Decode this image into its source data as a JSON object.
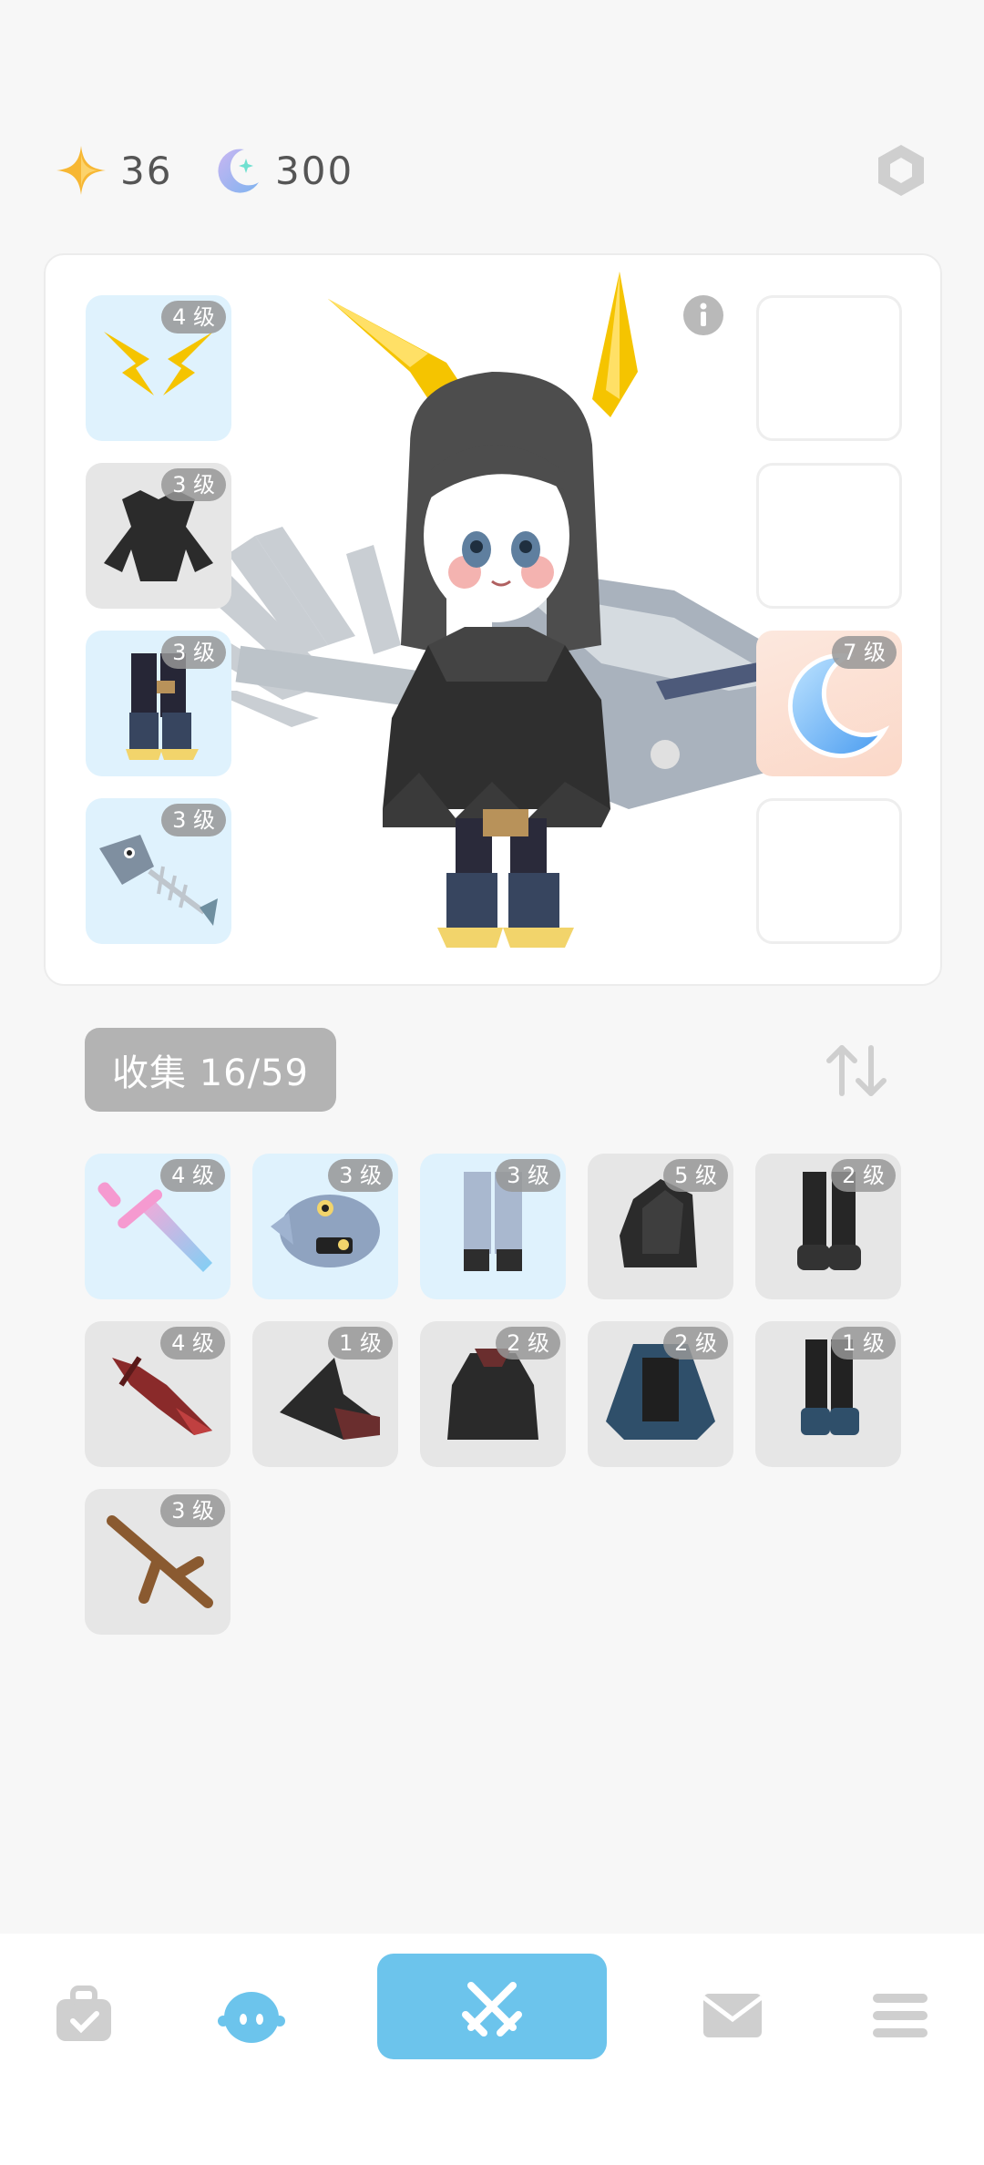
{
  "currencies": {
    "star": {
      "icon": "star-icon",
      "value": "36",
      "color": "#f7b733"
    },
    "moon": {
      "icon": "moon-icon",
      "value": "300",
      "color": "#8fb6f0"
    }
  },
  "settings": {
    "icon": "hexagon-settings-icon"
  },
  "equipment": {
    "left_slots": [
      {
        "name": "horns",
        "level": "4 级",
        "icon": "lightning-horns-icon"
      },
      {
        "name": "armor",
        "level": "3 级",
        "icon": "dark-armor-icon"
      },
      {
        "name": "boots",
        "level": "3 级",
        "icon": "claw-boots-icon"
      },
      {
        "name": "fish",
        "level": "3 级",
        "icon": "fish-skeleton-icon"
      }
    ],
    "right_slots": [
      {
        "name": "empty-1",
        "level": ""
      },
      {
        "name": "empty-2",
        "level": ""
      },
      {
        "name": "moon",
        "level": "7 级",
        "icon": "moon-icon"
      },
      {
        "name": "empty-3",
        "level": ""
      }
    ],
    "info_icon": "info-icon"
  },
  "collection": {
    "label": "收集 16/59",
    "sort_icon": "sort-arrows-icon"
  },
  "inventory": [
    {
      "level": "4 级",
      "icon": "pink-sword-icon",
      "bg": "blue"
    },
    {
      "level": "3 级",
      "icon": "fish-head-icon",
      "bg": "blue"
    },
    {
      "level": "3 级",
      "icon": "light-pants-icon",
      "bg": "blue"
    },
    {
      "level": "5 级",
      "icon": "dark-hood-icon",
      "bg": "gray"
    },
    {
      "level": "2 级",
      "icon": "black-boots-icon",
      "bg": "gray"
    },
    {
      "level": "4 级",
      "icon": "red-dragon-blade-icon",
      "bg": "gray"
    },
    {
      "level": "1 级",
      "icon": "witch-hat-icon",
      "bg": "gray"
    },
    {
      "level": "2 级",
      "icon": "dark-cloak-icon",
      "bg": "gray"
    },
    {
      "level": "2 级",
      "icon": "blue-robe-icon",
      "bg": "gray"
    },
    {
      "level": "1 级",
      "icon": "armored-boots-icon",
      "bg": "gray"
    },
    {
      "level": "3 级",
      "icon": "wooden-branch-icon",
      "bg": "gray"
    }
  ],
  "nav": {
    "items": [
      "bag-icon",
      "character-icon",
      "battle-icon",
      "mail-icon",
      "menu-icon"
    ],
    "active_color": "#6cc4ec",
    "inactive_color": "#cfcfcf"
  }
}
